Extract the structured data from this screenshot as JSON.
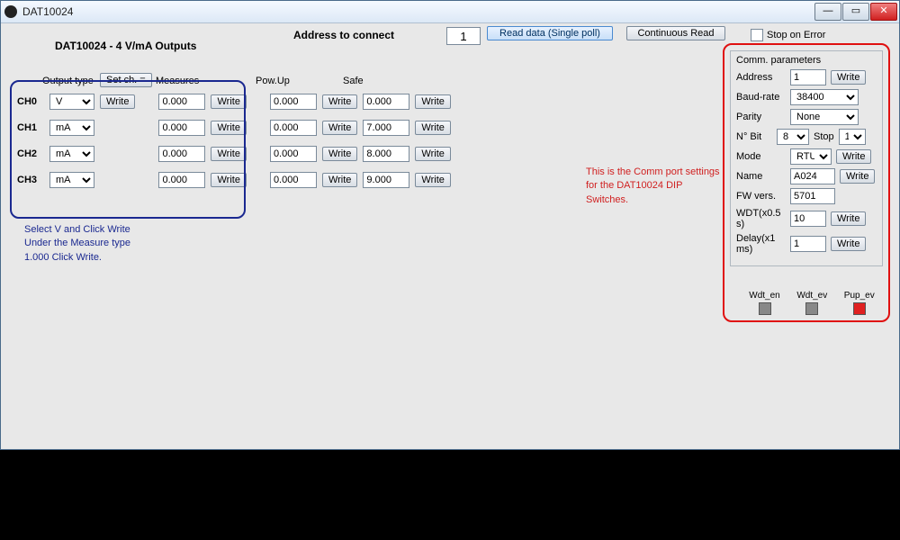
{
  "window_title": "DAT10024",
  "heading": "DAT10024 - 4 V/mA Outputs",
  "addr_label": "Address to connect",
  "addr_value": "1",
  "read_btn": "Read data (Single poll)",
  "cont_btn": "Continuous Read",
  "stop_err": "Stop on Error",
  "col": {
    "output": "Output type",
    "setch": "Set ch. =",
    "meas": "Measures",
    "powup": "Pow.Up",
    "safe": "Safe"
  },
  "write": "Write",
  "channels": [
    {
      "name": "CH0",
      "type": "V",
      "meas": "0.000",
      "powup": "0.000",
      "safe": "0.000"
    },
    {
      "name": "CH1",
      "type": "mA",
      "meas": "0.000",
      "powup": "0.000",
      "safe": "7.000"
    },
    {
      "name": "CH2",
      "type": "mA",
      "meas": "0.000",
      "powup": "0.000",
      "safe": "8.000"
    },
    {
      "name": "CH3",
      "type": "mA",
      "meas": "0.000",
      "powup": "0.000",
      "safe": "9.000"
    }
  ],
  "note_blue_1": "Select V and Click Write",
  "note_blue_2": "Under the Measure type",
  "note_blue_3": "1.000 Click Write.",
  "note_red": "This is the Comm port settings for the DAT10024 DIP Switches.",
  "comm": {
    "title": "Comm. parameters",
    "address_lbl": "Address",
    "address": "1",
    "baud_lbl": "Baud-rate",
    "baud": "38400",
    "parity_lbl": "Parity",
    "parity": "None",
    "nbit_lbl": "N° Bit",
    "nbit": "8",
    "stop_lbl": "Stop",
    "stop": "1",
    "mode_lbl": "Mode",
    "mode": "RTU",
    "name_lbl": "Name",
    "name": "A024",
    "fw_lbl": "FW vers.",
    "fw": "5701",
    "wdt_lbl": "WDT(x0.5 s)",
    "wdt": "10",
    "delay_lbl": "Delay(x1 ms)",
    "delay": "1"
  },
  "ind": {
    "wdt_en": "Wdt_en",
    "wdt_ev": "Wdt_ev",
    "pup_ev": "Pup_ev"
  }
}
